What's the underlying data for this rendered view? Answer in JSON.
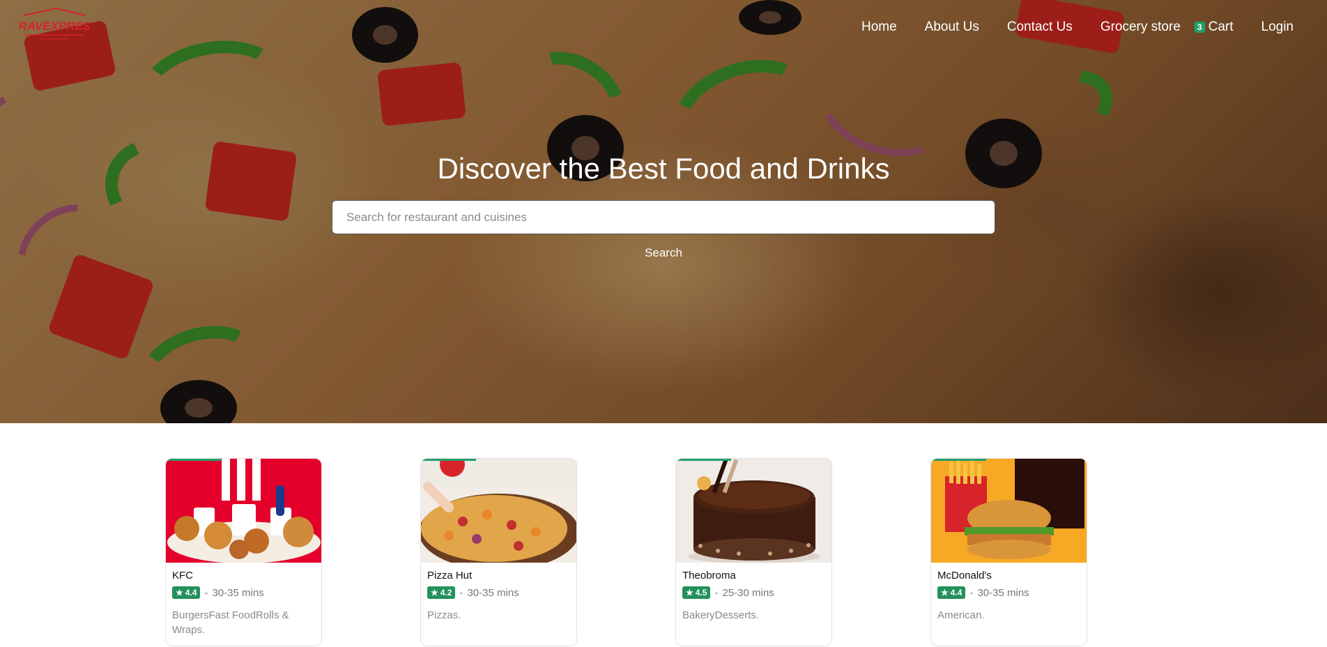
{
  "app": {
    "logo_alt": "CraveXpress logo",
    "logo_text": "CRAVEXPRESS"
  },
  "nav": {
    "items": [
      "Home",
      "About Us",
      "Contact Us",
      "Grocery store"
    ],
    "cart_count": "3",
    "cart_label": "Cart",
    "login_label": "Login"
  },
  "hero": {
    "title": "Discover the Best Food and Drinks",
    "search_placeholder": "Search for restaurant and cuisines",
    "search_button": "Search"
  },
  "restaurants": [
    {
      "name": "KFC",
      "rating": "4.4",
      "time": "30-35 mins",
      "cuisine": "BurgersFast FoodRolls & Wraps."
    },
    {
      "name": "Pizza Hut",
      "rating": "4.2",
      "time": "30-35 mins",
      "cuisine": "Pizzas."
    },
    {
      "name": "Theobroma",
      "rating": "4.5",
      "time": "25-30 mins",
      "cuisine": "BakeryDesserts."
    },
    {
      "name": "McDonald's",
      "rating": "4.4",
      "time": "30-35 mins",
      "cuisine": "American."
    }
  ],
  "separator": "-",
  "colors": {
    "accent_green": "#22a06b",
    "rating_green": "#22915e",
    "kfc_red": "#e4002b",
    "mcd_yellow": "#f7a824"
  },
  "icons": {
    "rating": "star-icon"
  }
}
